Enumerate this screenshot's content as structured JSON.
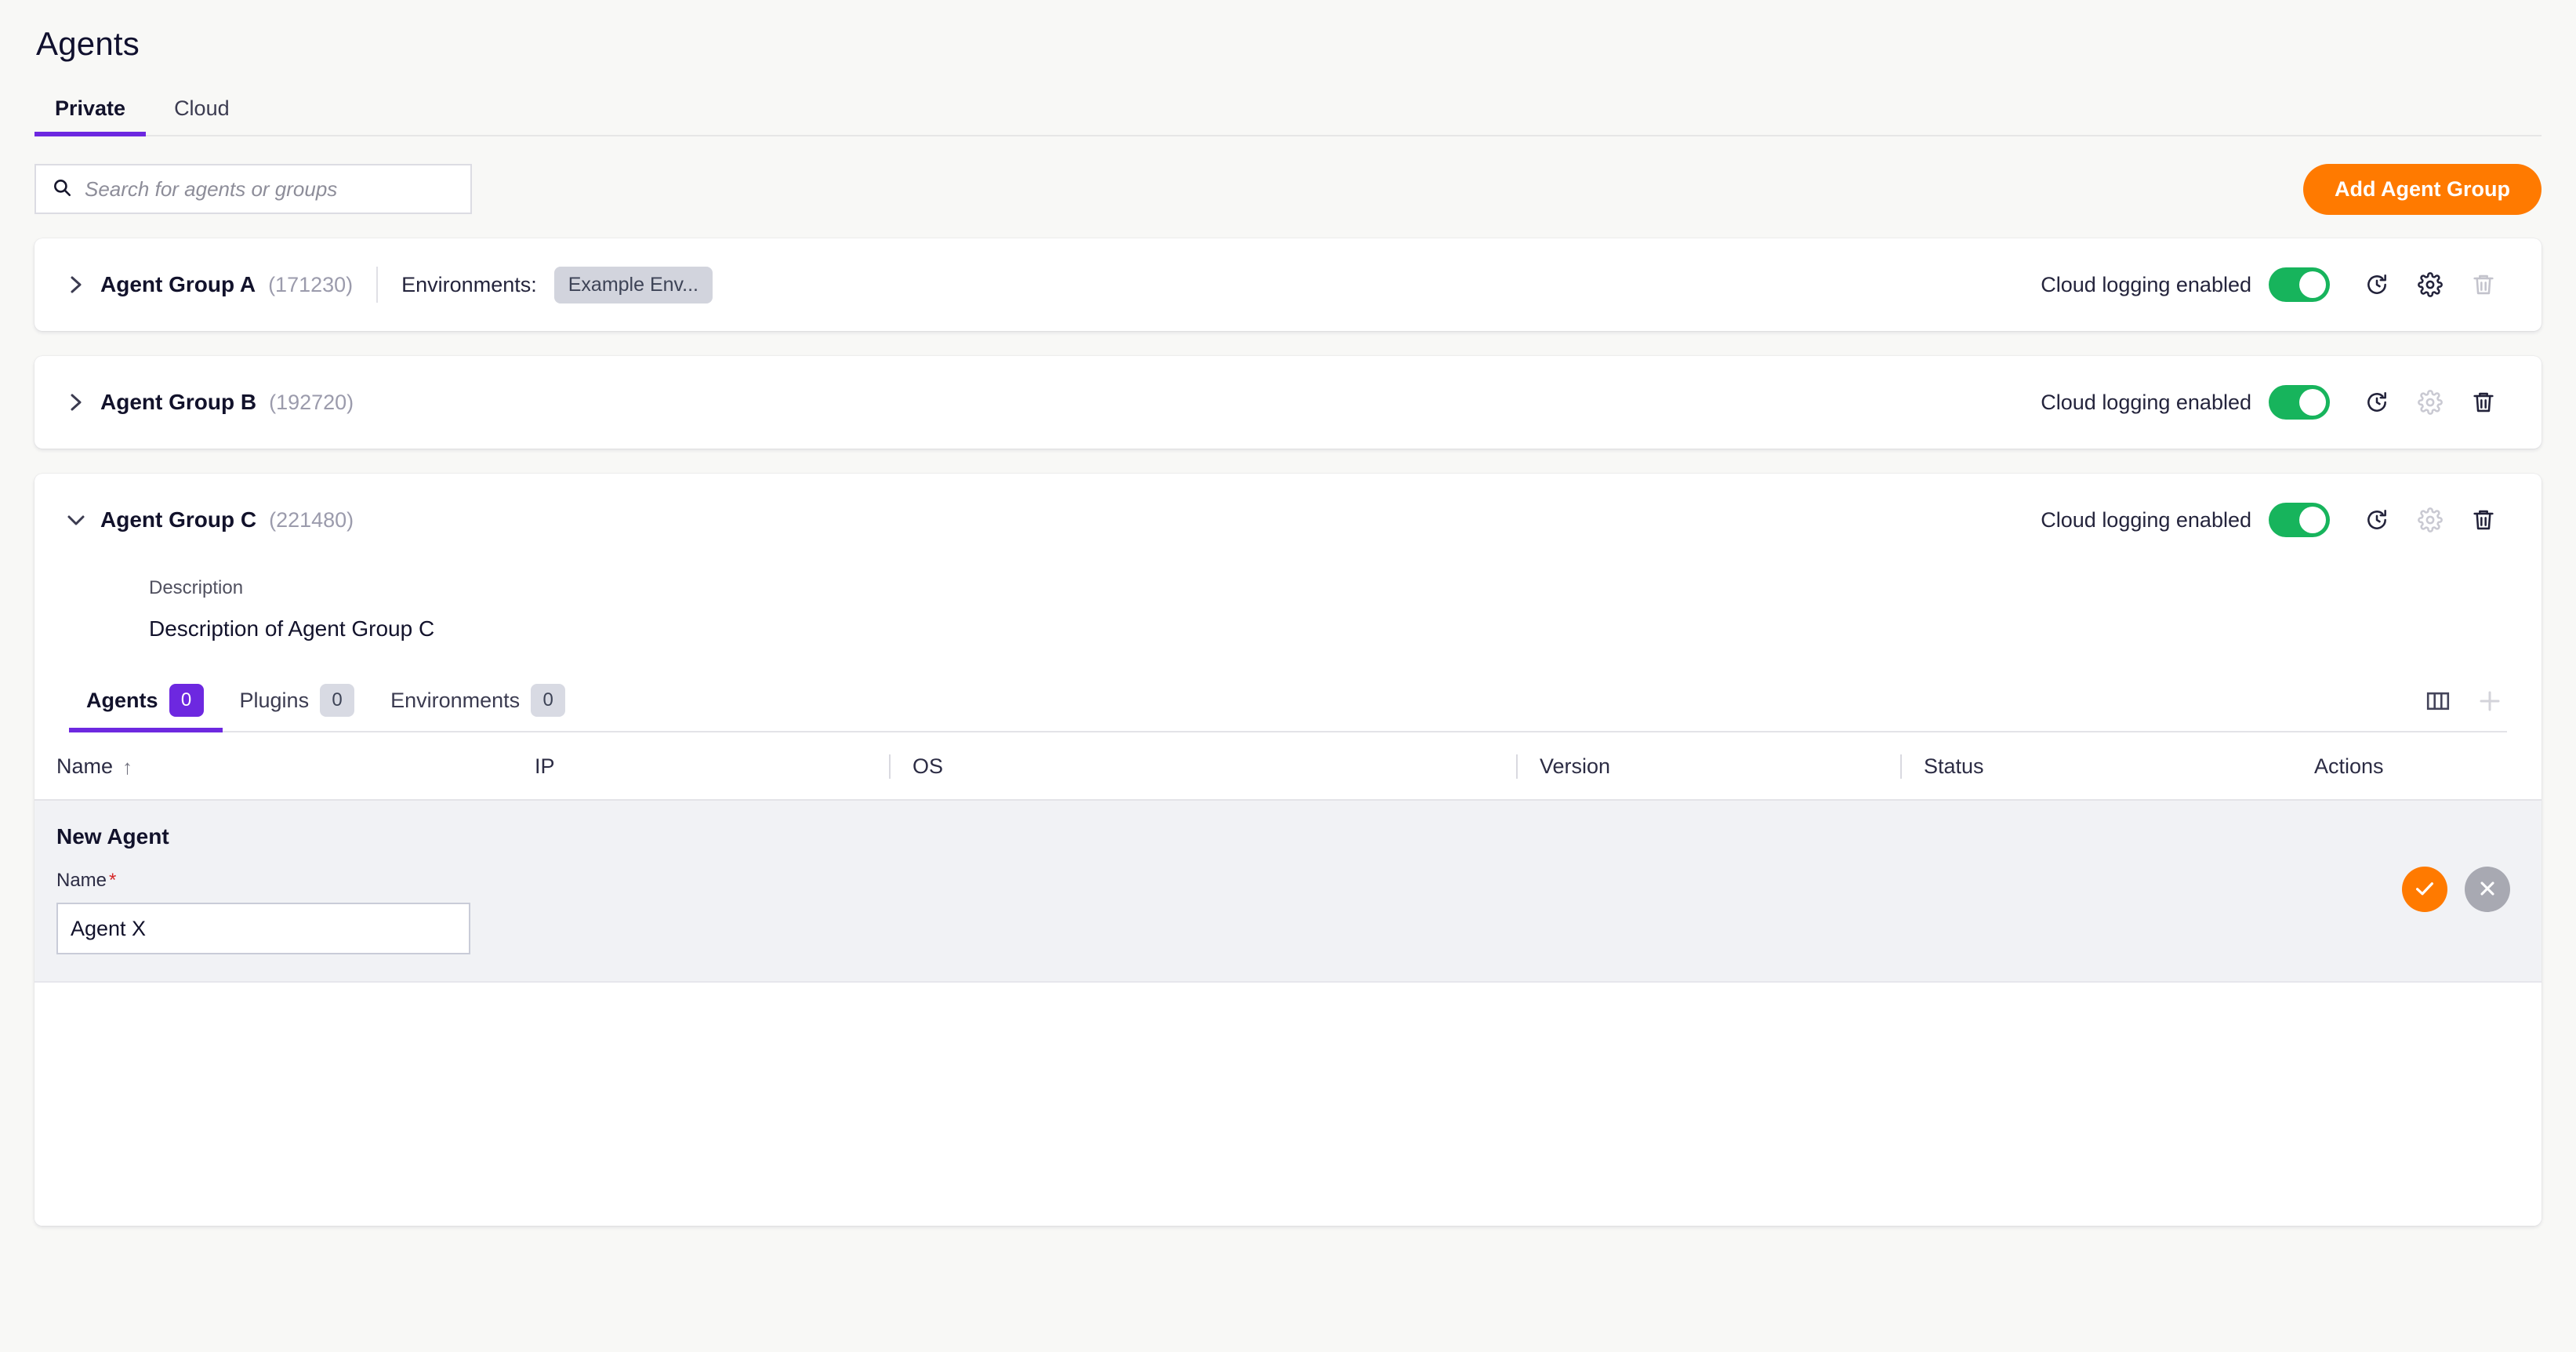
{
  "header": {
    "title": "Agents"
  },
  "top_tabs": [
    {
      "label": "Private",
      "active": true
    },
    {
      "label": "Cloud",
      "active": false
    }
  ],
  "search": {
    "placeholder": "Search for agents or groups",
    "value": "",
    "icon": "search-icon"
  },
  "actions": {
    "add_group_label": "Add Agent Group"
  },
  "colors": {
    "accent_purple": "#6d28e0",
    "accent_orange": "#ff7a00",
    "toggle_green": "#17b45c",
    "page_background": "#f8f8f6",
    "card_background": "#ffffff",
    "form_row_background": "#f1f2f5",
    "chip_background": "#d2d4dd",
    "required_red": "#d62828"
  },
  "groups": [
    {
      "name": "Agent Group A",
      "id": "(171230)",
      "expanded": false,
      "chevron": "chevron-right-icon",
      "environments_label": "Environments:",
      "environment_chip": "Example Env...",
      "cloud_logging_label": "Cloud logging enabled",
      "cloud_logging_on": true,
      "refresh_enabled": true,
      "settings_enabled": true,
      "delete_enabled": false
    },
    {
      "name": "Agent Group B",
      "id": "(192720)",
      "expanded": false,
      "chevron": "chevron-right-icon",
      "environments_label": "",
      "environment_chip": "",
      "cloud_logging_label": "Cloud logging enabled",
      "cloud_logging_on": true,
      "refresh_enabled": true,
      "settings_enabled": false,
      "delete_enabled": true
    },
    {
      "name": "Agent Group C",
      "id": "(221480)",
      "expanded": true,
      "chevron": "chevron-down-icon",
      "environments_label": "",
      "environment_chip": "",
      "cloud_logging_label": "Cloud logging enabled",
      "cloud_logging_on": true,
      "refresh_enabled": true,
      "settings_enabled": false,
      "delete_enabled": true,
      "description_label": "Description",
      "description_value": "Description of Agent Group C",
      "inner_tabs": [
        {
          "label": "Agents",
          "count": "0",
          "active": true
        },
        {
          "label": "Plugins",
          "count": "0",
          "active": false
        },
        {
          "label": "Environments",
          "count": "0",
          "active": false
        }
      ],
      "table_tools": [
        {
          "icon": "columns-icon",
          "enabled": true
        },
        {
          "icon": "plus-icon",
          "enabled": false
        }
      ],
      "table": {
        "columns": [
          {
            "label": "Name",
            "sorted": "asc",
            "sort_arrow": "↑",
            "separator": false
          },
          {
            "label": "IP",
            "separator": false
          },
          {
            "label": "OS",
            "separator": true
          },
          {
            "label": "Version",
            "separator": true
          },
          {
            "label": "Status",
            "separator": true
          },
          {
            "label": "Actions",
            "separator": false
          }
        ],
        "rows": [],
        "new_row": {
          "title": "New Agent",
          "name_label": "Name",
          "required_marker": "*",
          "name_value": "Agent X",
          "name_placeholder": "",
          "confirm_icon": "check-icon",
          "cancel_icon": "close-icon"
        }
      }
    }
  ]
}
